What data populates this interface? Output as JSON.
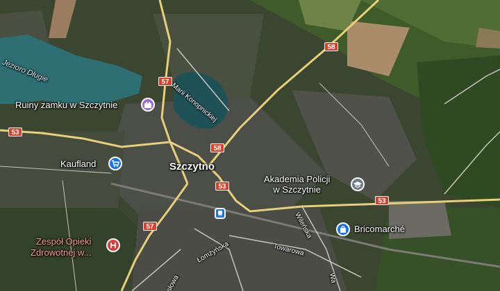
{
  "map": {
    "city_label": "Szczytno",
    "lake_label": "Jezioro Długie",
    "pois": [
      {
        "label": "Ruiny zamku w Szczytnie",
        "icon": "castle-icon",
        "color": "#9c6ad6"
      },
      {
        "label": "Kaufland",
        "icon": "shopping-cart-icon",
        "color": "#1a73e8"
      },
      {
        "label": "Akademia Policji",
        "label2": "w Szczytnie",
        "icon": "school-icon",
        "color": "#6f7b86"
      },
      {
        "label": "Bricomarché",
        "icon": "shopping-bag-icon",
        "color": "#1a73e8"
      },
      {
        "label": "Zespół Opieki",
        "label2": "Zdrowotnej w...",
        "icon": "hospital-icon",
        "color": "#e53935"
      }
    ],
    "streets": {
      "konopnickiej": "Marii Konopnickiej",
      "wilenska": "Wileńska",
      "lomzynska": "Łomżyńska",
      "towarowa": "Towarowa",
      "slowa": "słowa",
      "wa": "Wa"
    },
    "route_shields": {
      "r58_top": "58",
      "r57_top": "57",
      "r53_left": "53",
      "r58_mid": "58",
      "r53_mid": "53",
      "r53_right": "53",
      "r57_bottom": "57"
    },
    "transit_icon": "train-station-icon"
  }
}
